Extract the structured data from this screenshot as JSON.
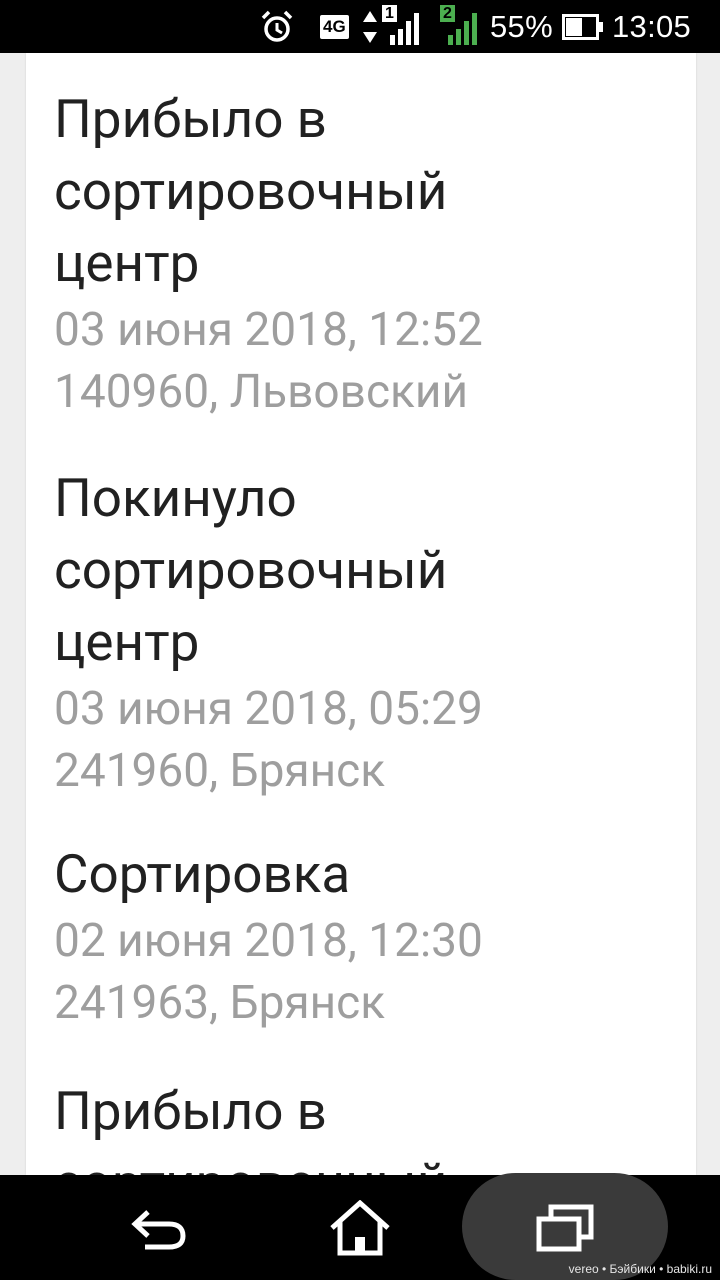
{
  "status_bar": {
    "network_type": "4G",
    "sim1_label": "1",
    "sim2_label": "2",
    "battery_percent": "55%",
    "battery_level": 0.55,
    "time": "13:05",
    "icons": [
      "alarm-icon",
      "data-arrows-icon",
      "signal-icon",
      "battery-icon"
    ],
    "sim2_color": "#4caf50"
  },
  "tracking_events": [
    {
      "status": "Прибыло в сортировочный центр",
      "datetime": "03 июня 2018, 12:52",
      "location": "140960, Львовский"
    },
    {
      "status": "Покинуло сортировочный центр",
      "datetime": "03 июня 2018, 05:29",
      "location": "241960, Брянск"
    },
    {
      "status": "Сортировка",
      "datetime": "02 июня 2018, 12:30",
      "location": "241963, Брянск"
    },
    {
      "status": "Прибыло в сортировочный центр"
    }
  ],
  "nav_bar": {
    "icons": [
      "back-icon",
      "home-icon",
      "recents-icon"
    ]
  },
  "watermark": "vereo • Бэйбики • babiki.ru"
}
